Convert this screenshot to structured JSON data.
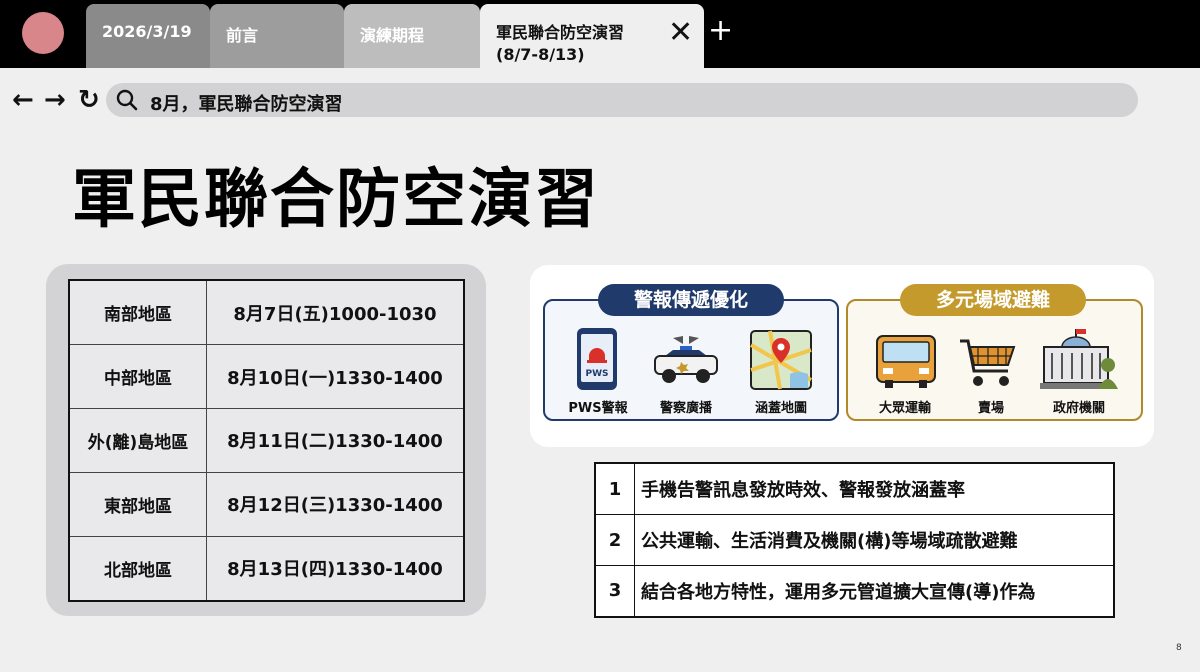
{
  "tabs": [
    {
      "label": "2026/3/19"
    },
    {
      "label": "前言"
    },
    {
      "label": "演練期程"
    },
    {
      "label": "軍民聯合防空演習 (8/7-8/13)"
    }
  ],
  "tab_close_symbol": "✕",
  "tab_add_symbol": "+",
  "nav": {
    "back": "←",
    "forward": "→",
    "reload": "↻"
  },
  "address": {
    "text": "8月，軍民聯合防空演習"
  },
  "page_title": "軍民聯合防空演習",
  "schedule": [
    {
      "region": "南部地區",
      "time": "8月7日(五)1000-1030"
    },
    {
      "region": "中部地區",
      "time": "8月10日(一)1330-1400"
    },
    {
      "region": "外(離)島地區",
      "time": "8月11日(二)1330-1400"
    },
    {
      "region": "東部地區",
      "time": "8月12日(三)1330-1400"
    },
    {
      "region": "北部地區",
      "time": "8月13日(四)1330-1400"
    }
  ],
  "panels": {
    "left": {
      "title": "警報傳遞優化",
      "items": [
        {
          "label": "PWS警報",
          "icon": "phone-alert-icon",
          "badge": "PWS"
        },
        {
          "label": "警察廣播",
          "icon": "police-car-icon"
        },
        {
          "label": "涵蓋地圖",
          "icon": "map-icon"
        }
      ]
    },
    "right": {
      "title": "多元場域避難",
      "items": [
        {
          "label": "大眾運輸",
          "icon": "bus-icon"
        },
        {
          "label": "賣場",
          "icon": "shopping-cart-icon"
        },
        {
          "label": "政府機關",
          "icon": "government-building-icon"
        }
      ]
    }
  },
  "goals": [
    {
      "num": "1",
      "text": "手機告警訊息發放時效、警報發放涵蓋率"
    },
    {
      "num": "2",
      "text": "公共運輸、生活消費及機關(構)等場域疏散避難"
    },
    {
      "num": "3",
      "text": "結合各地方特性，運用多元管道擴大宣傳(導)作為"
    }
  ],
  "page_number": "8",
  "colors": {
    "blue": "#1f3a6b",
    "gold": "#c49a2c",
    "circle": "#d9868a"
  }
}
